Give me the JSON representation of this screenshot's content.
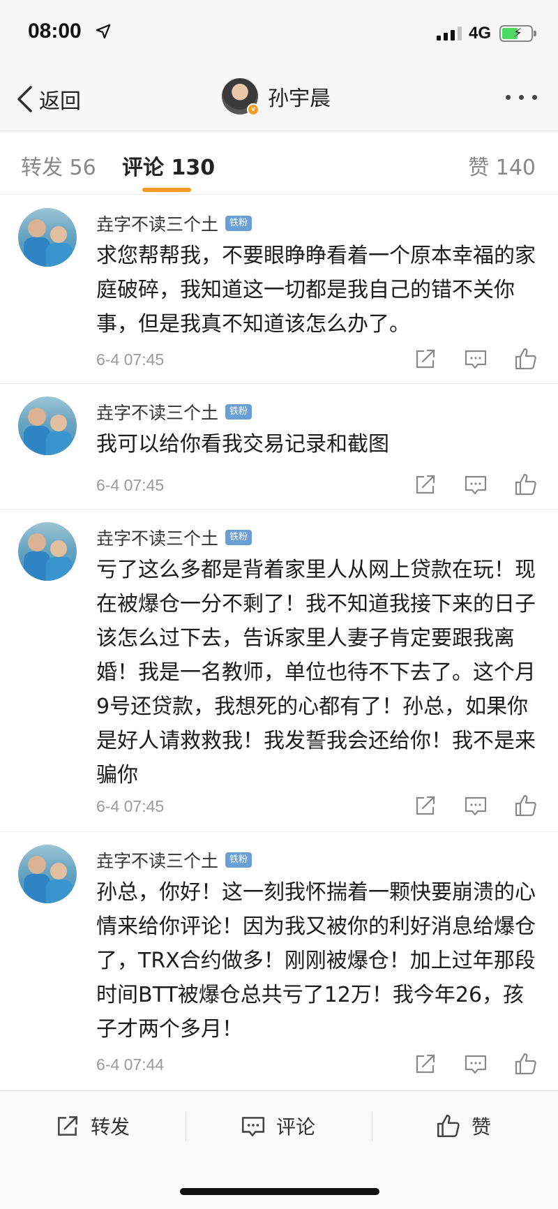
{
  "status_bar": {
    "time": "08:00",
    "network": "4G"
  },
  "nav": {
    "back_label": "返回",
    "title": "孙宇晨"
  },
  "tabs": [
    {
      "label": "转发 56"
    },
    {
      "label": "评论 130"
    },
    {
      "label": "赞 140"
    }
  ],
  "comments": [
    {
      "name": "垚字不读三个土",
      "badge": "铁粉",
      "text": "求您帮帮我，不要眼睁睁看着一个原本幸福的家庭破碎，我知道这一切都是我自己的错不关你事，但是我真不知道该怎么办了。",
      "time": "6-4 07:45"
    },
    {
      "name": "垚字不读三个土",
      "badge": "铁粉",
      "text": "我可以给你看我交易记录和截图",
      "time": "6-4 07:45"
    },
    {
      "name": "垚字不读三个土",
      "badge": "铁粉",
      "text": "亏了这么多都是背着家里人从网上贷款在玩！现在被爆仓一分不剩了！我不知道我接下来的日子该怎么过下去，告诉家里人妻子肯定要跟我离婚！我是一名教师，单位也待不下去了。这个月9号还贷款，我想死的心都有了！孙总，如果你是好人请救救我！我发誓我会还给你！我不是来骗你",
      "time": "6-4 07:45"
    },
    {
      "name": "垚字不读三个土",
      "badge": "铁粉",
      "text": "孙总，你好！这一刻我怀揣着一颗快要崩溃的心情来给你评论！因为我又被你的利好消息给爆仓了，TRX合约做多！刚刚被爆仓！加上过年那段时间BTT被爆仓总共亏了12万！我今年26，孩子才两个多月！",
      "time": "6-4 07:44"
    }
  ],
  "bottom_bar": {
    "repost": "转发",
    "comment": "评论",
    "like": "赞"
  },
  "colors": {
    "accent": "#f59a23",
    "badge": "#6a9fd6",
    "battery": "#4cd964"
  },
  "icons": [
    "location-arrow-icon",
    "signal-icon",
    "battery-icon",
    "back-chevron-icon",
    "more-dots-icon",
    "share-icon",
    "comment-icon",
    "like-icon"
  ]
}
